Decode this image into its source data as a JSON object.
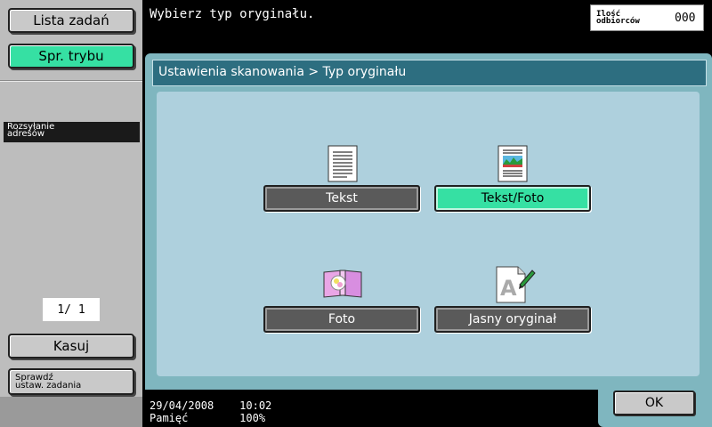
{
  "sidebar": {
    "job_list_label": "Lista zadań",
    "mode_check_label": "Spr. trybu",
    "address_dist_label": "Rozsyłanie\nadresów",
    "page_counter": "1/  1",
    "delete_label": "Kasuj",
    "check_job_label": "Sprawdź\nustaw. zadania"
  },
  "header": {
    "message": "Wybierz typ oryginału.",
    "recipients_label": "Ilość\nodbiorców",
    "recipients_count": "000"
  },
  "panel": {
    "breadcrumb": "Ustawienia skanowania > Typ oryginału",
    "options": [
      {
        "label": "Tekst",
        "icon": "text-document-icon",
        "selected": false
      },
      {
        "label": "Tekst/Foto",
        "icon": "text-photo-document-icon",
        "selected": true
      },
      {
        "label": "Foto",
        "icon": "photo-album-icon",
        "selected": false
      },
      {
        "label": "Jasny oryginał",
        "icon": "light-original-icon",
        "selected": false
      }
    ]
  },
  "status": {
    "date": "29/04/2008",
    "time": "10:02",
    "memory_label": "Pamięć",
    "memory_value": "100%"
  },
  "footer": {
    "ok_label": "OK"
  },
  "colors": {
    "accent_green": "#36e0a3",
    "panel_teal": "#7fb6bf",
    "title_bar": "#2d6e80"
  }
}
